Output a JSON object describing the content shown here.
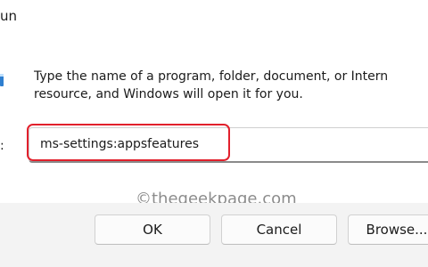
{
  "window": {
    "title": "un"
  },
  "dialog": {
    "description_line1": "Type the name of a program, folder, document, or Intern",
    "description_line2": "resource, and Windows will open it for you.",
    "open_label": ":",
    "open_value": "ms-settings:appsfeatures"
  },
  "watermark": "©thegeekpage.com",
  "buttons": {
    "ok": "OK",
    "cancel": "Cancel",
    "browse": "Browse..."
  },
  "colors": {
    "highlight": "#e2202c",
    "footer_background": "#f3f3f3",
    "icon_accent": "#2f7fd0"
  },
  "icons": {
    "run": "run-dialog-icon"
  }
}
